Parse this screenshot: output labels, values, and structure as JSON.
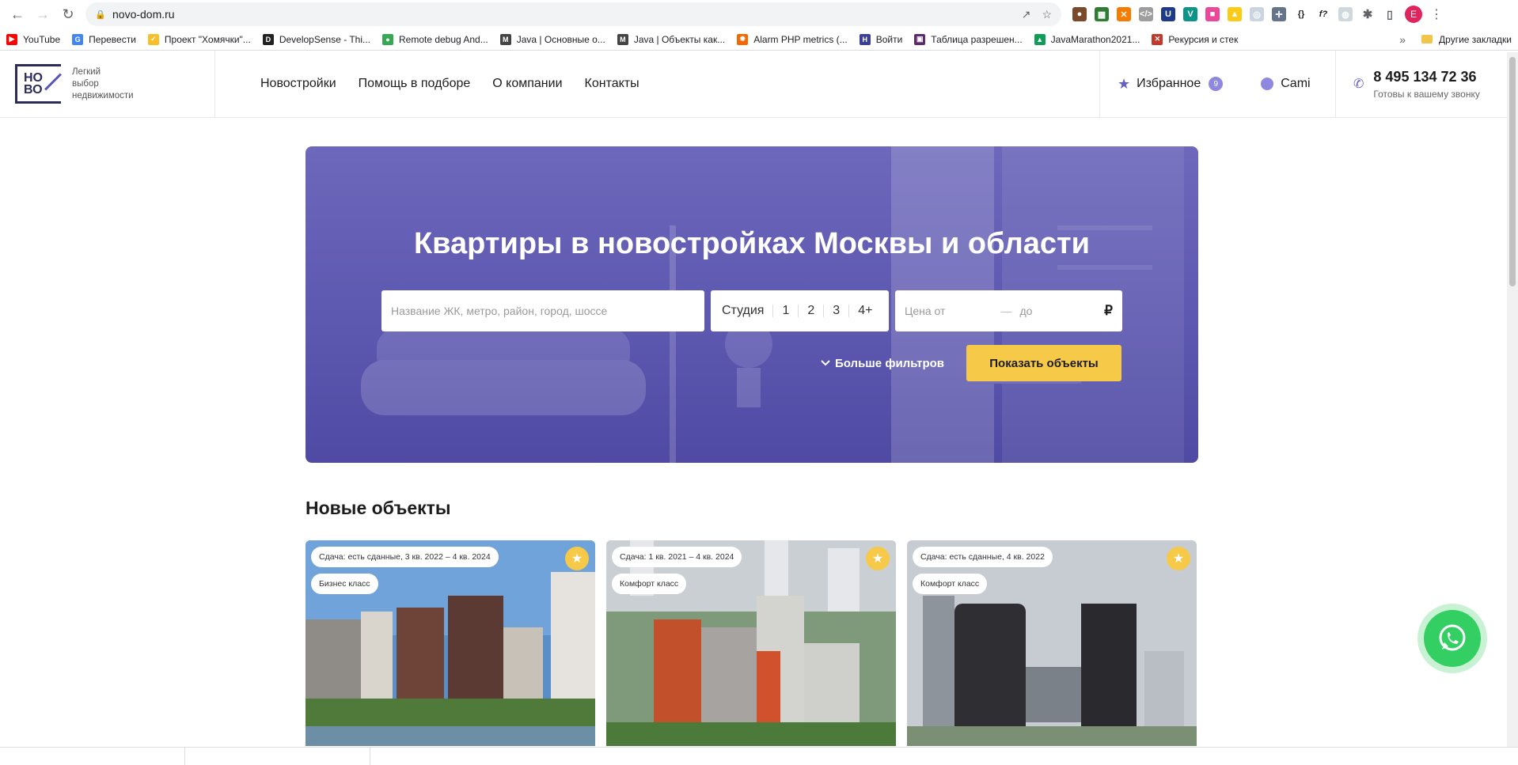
{
  "browser": {
    "url": "novo-dom.ru",
    "bookmarks": [
      {
        "label": "YouTube",
        "color": "#ff0000",
        "glyph": "▶"
      },
      {
        "label": "Перевести",
        "color": "#4285f4",
        "glyph": "G"
      },
      {
        "label": "Проект \"Хомячки\"...",
        "color": "#f6c026",
        "glyph": "✓"
      },
      {
        "label": "DevelopSense - Thi...",
        "color": "#222222",
        "glyph": "D"
      },
      {
        "label": "Remote debug And...",
        "color": "#34a853",
        "glyph": "●"
      },
      {
        "label": "Java | Основные о...",
        "color": "#444444",
        "glyph": "M"
      },
      {
        "label": "Java | Объекты как...",
        "color": "#444444",
        "glyph": "M"
      },
      {
        "label": "Alarm PHP metrics (...",
        "color": "#f46800",
        "glyph": "✹"
      },
      {
        "label": "Войти",
        "color": "#3c3f9a",
        "glyph": "H"
      },
      {
        "label": "Таблица разрешен...",
        "color": "#5b2b6e",
        "glyph": "▣"
      },
      {
        "label": "JavaMarathon2021...",
        "color": "#0f9d58",
        "glyph": "▲"
      },
      {
        "label": "Рекурсия и стек",
        "color": "#c0392b",
        "glyph": "✕"
      }
    ],
    "other_bookmarks": "Другие закладки",
    "profile_initial": "E"
  },
  "header": {
    "logo_line1": "НО",
    "logo_line2": "ВО",
    "tagline_1": "Легкий",
    "tagline_2": "выбор",
    "tagline_3": "недвижимости",
    "nav": [
      "Новостройки",
      "Помощь в подборе",
      "О компании",
      "Контакты"
    ],
    "favorites_label": "Избранное",
    "favorites_count": "9",
    "user_name": "Cami",
    "phone": "8 495 134 72 36",
    "phone_note": "Готовы к вашему звонку"
  },
  "hero": {
    "title": "Квартиры в новостройках Москвы и области",
    "search_placeholder": "Название ЖК, метро, район, город, шоссе",
    "room_options": [
      "Студия",
      "1",
      "2",
      "3",
      "4+"
    ],
    "price_from": "Цена от",
    "price_dash": "—",
    "price_to": "до",
    "currency": "₽",
    "more_filters": "Больше фильтров",
    "show_button": "Показать объекты"
  },
  "new_objects": {
    "title": "Новые объекты",
    "cards": [
      {
        "delivery": "Сдача: есть сданные, 3 кв. 2022 – 4 кв. 2024",
        "class": "Бизнес класс"
      },
      {
        "delivery": "Сдача: 1 кв. 2021 – 4 кв. 2024",
        "class": "Комфорт класс"
      },
      {
        "delivery": "Сдача: есть сданные, 4 кв. 2022",
        "class": "Комфорт класс"
      }
    ]
  },
  "colors": {
    "accent": "#6760c4",
    "hero": "#5d58b0",
    "cta": "#f7c948",
    "whatsapp": "#34cf63"
  }
}
